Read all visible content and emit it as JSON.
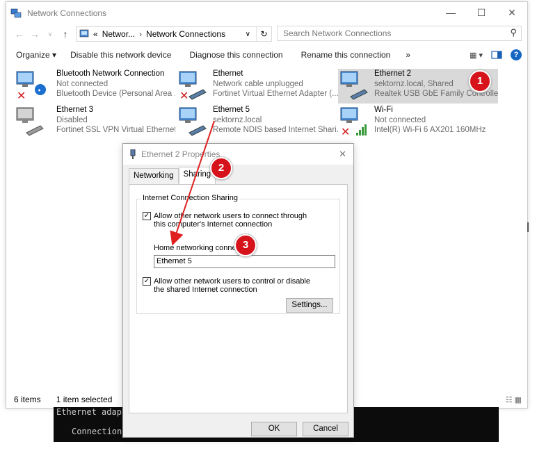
{
  "window": {
    "title": "Network Connections",
    "breadcrumb": [
      "Networ...",
      "Network Connections"
    ],
    "breadcrumb_prefix": "«",
    "search_placeholder": "Search Network Connections"
  },
  "toolbar": {
    "organize": "Organize ▾",
    "disable": "Disable this network device",
    "diagnose": "Diagnose this connection",
    "rename": "Rename this connection",
    "more": "»"
  },
  "connections": [
    {
      "name": "Bluetooth Network Connection",
      "status": "Not connected",
      "device": "Bluetooth Device (Personal Area ..."
    },
    {
      "name": "Ethernet",
      "status": "Network cable unplugged",
      "device": "Fortinet Virtual Ethernet Adapter (..."
    },
    {
      "name": "Ethernet 2",
      "status": "sektornz.local, Shared",
      "device": "Realtek USB GbE Family Controlle..."
    },
    {
      "name": "Ethernet 3",
      "status": "Disabled",
      "device": "Fortinet SSL VPN Virtual Ethernet ..."
    },
    {
      "name": "Ethernet 5",
      "status": "sektornz.local",
      "device": "Remote NDIS based Internet Shari..."
    },
    {
      "name": "Wi-Fi",
      "status": "Not connected",
      "device": "Intel(R) Wi-Fi 6 AX201 160MHz"
    }
  ],
  "status": {
    "items": "6 items",
    "selected": "1 item selected"
  },
  "console": {
    "line1": "Ethernet adap",
    "line2": "Connection"
  },
  "dialog": {
    "title": "Ethernet 2 Properties",
    "tabs": [
      "Networking",
      "Sharing"
    ],
    "group_title": "Internet Connection Sharing",
    "allow_connect": "Allow other network users to connect through this computer's Internet connection",
    "allow_connect_checked": true,
    "home_label": "Home networking connection:",
    "home_value": "Ethernet 5",
    "allow_control": "Allow other network users to control or disable the shared Internet connection",
    "allow_control_checked": true,
    "settings": "Settings...",
    "ok": "OK",
    "cancel": "Cancel"
  },
  "annotations": [
    "1",
    "2",
    "3"
  ],
  "colors": {
    "badge": "#d6131b",
    "arrow": "#e0201f",
    "selection": "#d9d9d9",
    "help": "#1466c2"
  }
}
